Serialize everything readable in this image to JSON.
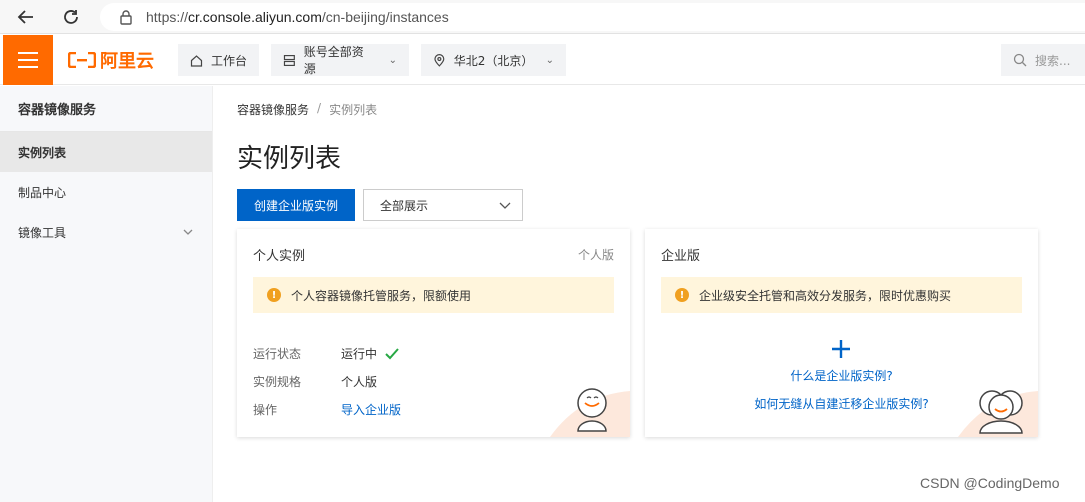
{
  "browser": {
    "url_prefix": "https://",
    "url_host": "cr.console.aliyun.com",
    "url_path": "/cn-beijing/instances"
  },
  "header": {
    "logo_text": "阿里云",
    "workbench_label": "工作台",
    "resources_label": "账号全部资源",
    "region_label": "华北2（北京）",
    "search_placeholder": "搜索...",
    "accent_color": "#ff6a00"
  },
  "sidebar": {
    "title": "容器镜像服务",
    "items": [
      {
        "label": "实例列表",
        "active": true
      },
      {
        "label": "制品中心",
        "active": false
      },
      {
        "label": "镜像工具",
        "active": false,
        "expandable": true
      }
    ]
  },
  "main": {
    "breadcrumb": {
      "root": "容器镜像服务",
      "sep": "/",
      "current": "实例列表"
    },
    "title": "实例列表",
    "create_button": "创建企业版实例",
    "filter_value": "全部展示",
    "personal_card": {
      "title": "个人实例",
      "tag": "个人版",
      "notice": "个人容器镜像托管服务，限额使用",
      "rows": [
        {
          "key": "运行状态",
          "value": "运行中"
        },
        {
          "key": "实例规格",
          "value": "个人版"
        },
        {
          "key": "操作",
          "value": "导入企业版"
        }
      ]
    },
    "enterprise_card": {
      "title": "企业版",
      "notice": "企业级安全托管和高效分发服务，限时优惠购买",
      "link_what": "什么是企业版实例?",
      "link_migrate": "如何无缝从自建迁移企业版实例?"
    }
  },
  "watermark": "CSDN @CodingDemo",
  "colors": {
    "primary": "#0064c8",
    "success": "#27a844",
    "warning": "#f0a020",
    "notice_bg": "#fff5dc"
  }
}
